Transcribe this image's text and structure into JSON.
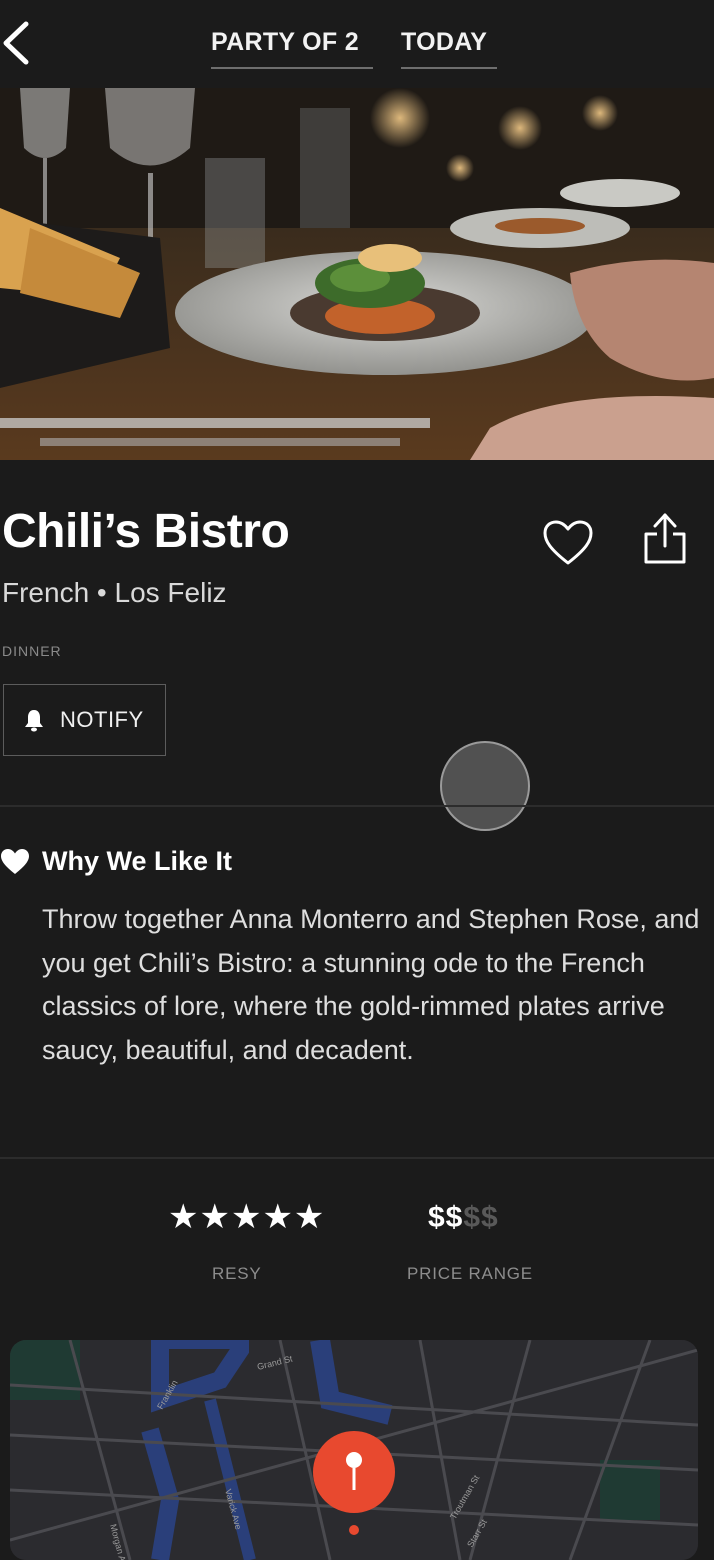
{
  "header": {
    "back_icon": "chevron-left-icon",
    "party": "PARTY OF 2",
    "date": "TODAY"
  },
  "restaurant": {
    "name": "Chili’s Bistro",
    "subtitle": "French • Los Feliz",
    "meal": "DINNER"
  },
  "actions": {
    "favorite_icon": "heart-outline-icon",
    "share_icon": "share-icon",
    "notify_label": "NOTIFY",
    "notify_icon": "bell-icon"
  },
  "why": {
    "title": "Why We Like It",
    "icon": "heart-icon",
    "body": "Throw together Anna Monterro and Stephen Rose, and you get Chili’s Bistro: a stunning ode to the French classics of lore, where the gold-rimmed plates arrive saucy, beautiful, and decadent."
  },
  "ratings": {
    "stars": "★★★★★",
    "stars_count": 5,
    "stars_max": 5,
    "stars_label": "RESY",
    "price_active": "$$",
    "price_inactive": "$$",
    "price_level": 2,
    "price_max": 4,
    "price_label": "PRICE RANGE"
  },
  "map": {
    "labels": [
      "Grand St",
      "Franklin",
      "Morgan Ave",
      "Varick Ave",
      "Troutman St",
      "Starr St"
    ],
    "pin_color": "#e8492f",
    "pin_icon": "map-pin-icon"
  },
  "colors": {
    "background": "#1b1b1b",
    "accent_pin": "#e8492f"
  }
}
